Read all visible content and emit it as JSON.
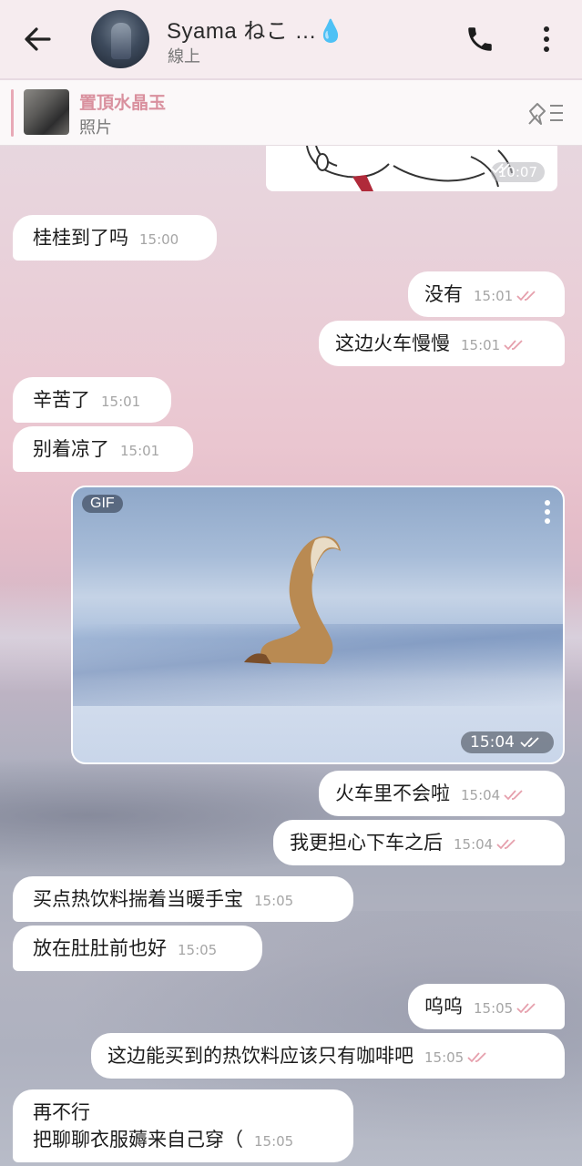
{
  "header": {
    "contact_name": "Syama ねこ …💧",
    "status": "線上"
  },
  "pinned": {
    "title": "置頂水晶玉",
    "subtitle": "照片"
  },
  "sticker": {
    "time": "10:07"
  },
  "gif": {
    "badge": "GIF",
    "time": "15:04"
  },
  "colors": {
    "bubble": "#ffffff",
    "read_check": "#e6a0ad",
    "pinned_title": "#d9909e"
  },
  "messages": [
    {
      "text": "桂桂到了吗",
      "time": "15:00",
      "dir": "in"
    },
    {
      "text": "没有",
      "time": "15:01",
      "dir": "out"
    },
    {
      "text": "这边火车慢慢",
      "time": "15:01",
      "dir": "out"
    },
    {
      "text": "辛苦了",
      "time": "15:01",
      "dir": "in"
    },
    {
      "text": "别着凉了",
      "time": "15:01",
      "dir": "in"
    },
    {
      "text": "火车里不会啦",
      "time": "15:04",
      "dir": "out"
    },
    {
      "text": "我更担心下车之后",
      "time": "15:04",
      "dir": "out"
    },
    {
      "text": "买点热饮料揣着当暖手宝",
      "time": "15:05",
      "dir": "in"
    },
    {
      "text": "放在肚肚前也好",
      "time": "15:05",
      "dir": "in"
    },
    {
      "text": "呜呜",
      "time": "15:05",
      "dir": "out"
    },
    {
      "text": "这边能买到的热饮料应该只有咖啡吧",
      "time": "15:05",
      "dir": "out"
    },
    {
      "line1": "再不行",
      "line2": "把聊聊衣服薅来自己穿（",
      "time": "15:05",
      "dir": "in"
    }
  ]
}
